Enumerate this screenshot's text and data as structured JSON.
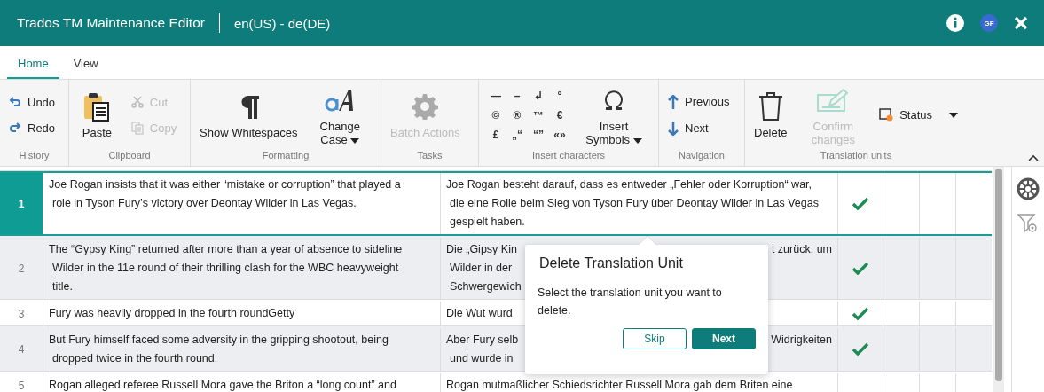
{
  "window": {
    "title": "Trados TM Maintenance Editor",
    "language_pair": "en(US) - de(DE)",
    "avatar": "GF"
  },
  "tabs": [
    {
      "label": "Home",
      "selected": true
    },
    {
      "label": "View",
      "selected": false
    }
  ],
  "ribbon_groups": [
    {
      "label": "History",
      "items": [
        {
          "kind": "small",
          "label": "Undo",
          "disabled": false
        },
        {
          "kind": "small",
          "label": "Redo",
          "disabled": false
        }
      ]
    },
    {
      "label": "Clipboard",
      "items": [
        {
          "kind": "large",
          "label": "Paste",
          "disabled": false
        },
        {
          "kind": "small",
          "label": "Cut",
          "disabled": true
        },
        {
          "kind": "small",
          "label": "Copy",
          "disabled": true
        }
      ]
    },
    {
      "label": "Formatting",
      "items": [
        {
          "kind": "large",
          "label": "Show Whitespaces",
          "disabled": false
        },
        {
          "kind": "large",
          "label": "Change Case",
          "disabled": false,
          "dropdown": true
        }
      ]
    },
    {
      "label": "Tasks",
      "items": [
        {
          "kind": "large",
          "label": "Batch Actions",
          "disabled": true
        }
      ]
    },
    {
      "label": "Insert characters",
      "items": [
        {
          "kind": "symbols",
          "symbols": [
            "—",
            "–",
            "↲",
            "°",
            "©",
            "®",
            "™",
            "€",
            "£",
            "„“",
            "“”",
            "«»"
          ]
        },
        {
          "kind": "large",
          "label": "Insert Symbols",
          "disabled": false,
          "dropdown": true
        }
      ]
    },
    {
      "label": "Navigation",
      "items": [
        {
          "kind": "small",
          "label": "Previous",
          "disabled": false
        },
        {
          "kind": "small",
          "label": "Next",
          "disabled": false
        }
      ]
    },
    {
      "label": "Translation units",
      "items": [
        {
          "kind": "large",
          "label": "Delete",
          "disabled": false
        },
        {
          "kind": "large",
          "label": "Confirm changes",
          "disabled": true
        },
        {
          "kind": "small",
          "label": "Status",
          "disabled": false,
          "dropdown": true
        }
      ]
    }
  ],
  "rows": [
    {
      "number": "1",
      "selected": true,
      "confirmed": true,
      "source": [
        "Joe Rogan insists that it was either “mistake or corruption” that played a",
        "role in Tyson Fury’s victory over Deontay Wilder in Las Vegas."
      ],
      "target": [
        {
          "left": "Joe Rogan besteht darauf, dass es entweder „Fehler oder Korruption“ war,"
        },
        {
          "left": "die eine Rolle beim Sieg von Tyson Fury über Deontay Wilder in Las Vegas"
        },
        {
          "left": "gespielt haben."
        }
      ]
    },
    {
      "number": "2",
      "selected": false,
      "confirmed": true,
      "source": [
        "The “Gypsy King” returned after more than a year of absence to sideline",
        "Wilder in the 11e round of their thrilling clash for the WBC heavyweight",
        "title."
      ],
      "target": [
        {
          "left": "Die „Gipsy Kin",
          "right": "t zurück, um"
        },
        {
          "left": "Wilder in der"
        },
        {
          "left": "Schwergewich"
        }
      ]
    },
    {
      "number": "3",
      "selected": false,
      "confirmed": true,
      "source": [
        "Fury was heavily dropped in the fourth roundGetty"
      ],
      "target": [
        {
          "left": "Die Wut wurd"
        }
      ]
    },
    {
      "number": "4",
      "selected": false,
      "confirmed": true,
      "source": [
        "But Fury himself faced some adversity in the gripping shootout, being",
        "dropped twice in the fourth round."
      ],
      "target": [
        {
          "left": "Aber Fury selb",
          "right": "Widrigkeiten"
        },
        {
          "left": "und wurde in"
        }
      ]
    },
    {
      "number": "5",
      "selected": false,
      "source": [
        "Rogan alleged referee Russell Mora gave the Briton a “long count” and"
      ],
      "target": [
        {
          "left": "Rogan mutmaßlicher Schiedsrichter Russell Mora gab dem Briten eine"
        }
      ]
    }
  ],
  "popup": {
    "title": "Delete Translation Unit",
    "text": "Select the translation unit you want to delete.",
    "buttons": [
      {
        "label": "Skip",
        "kind": "secondary"
      },
      {
        "label": "Next",
        "kind": "primary"
      }
    ]
  }
}
